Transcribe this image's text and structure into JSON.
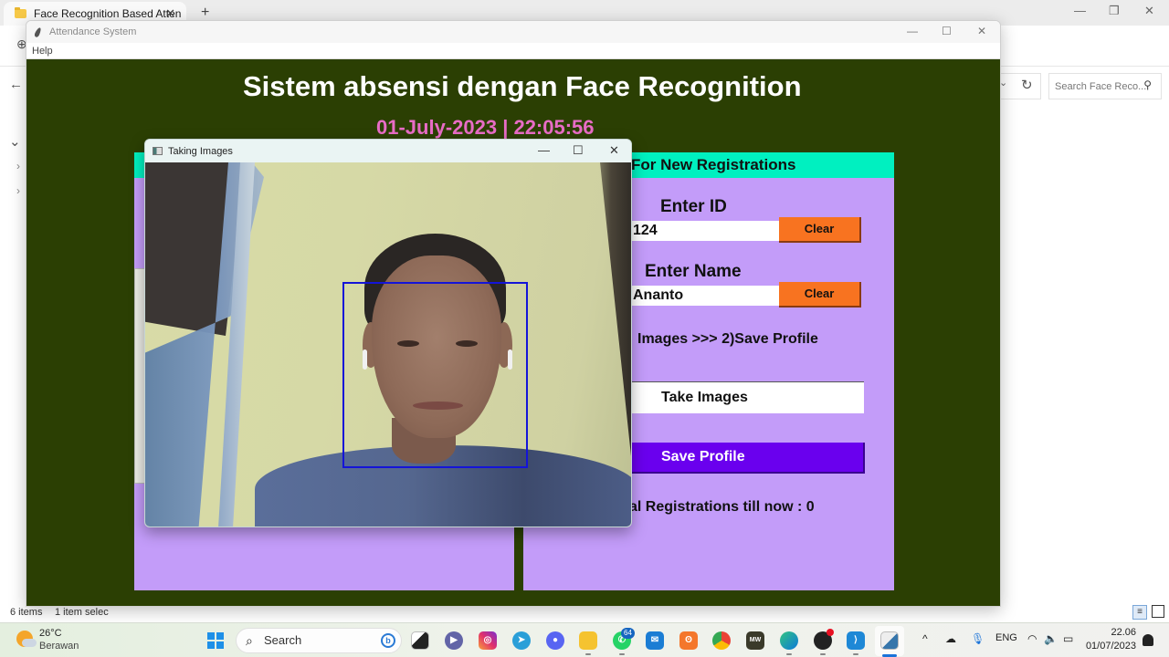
{
  "explorer": {
    "tab_title": "Face Recognition Based Atten",
    "tab_close": "✕",
    "new_tab": "+",
    "window_controls": {
      "minimize": "—",
      "maximize": "❐",
      "close": "✕"
    },
    "nav": {
      "back": "←",
      "expand": "⌄",
      "tree_arrow_1": "›",
      "tree_arrow_2": "›",
      "add": "⊕",
      "dropdown": "⌄"
    },
    "refresh": "↻",
    "search_placeholder": "Search Face Reco...",
    "search_icon": "⚲",
    "status": {
      "items": "6 items",
      "selected": "1 item selec"
    },
    "view_details": "≡"
  },
  "tk_app": {
    "window_title": "Attendance System",
    "window_controls": {
      "minimize": "—",
      "maximize": "☐",
      "close": "✕"
    },
    "menu": [
      "Help"
    ],
    "title": "Sistem absensi dengan Face Recognition",
    "datetime": "01-July-2023  |  22:05:56",
    "colors": {
      "background": "#2b3f03",
      "panel": "#c39cf9",
      "header": "#00f0c0",
      "clear_button": "#f87320",
      "save_button": "#6a00ee",
      "datetime": "#e86cc6"
    },
    "registration": {
      "header": "For New Registrations",
      "id_label": "Enter ID",
      "id_value": "124",
      "name_label": "Enter Name",
      "name_value": "Ananto",
      "clear_label": "Clear",
      "steps": "Images  >>>  2)Save Profile",
      "take_images": "Take Images",
      "save_profile": "Save Profile",
      "total": "al Registrations till now  : 0"
    }
  },
  "capture_window": {
    "title": "Taking Images",
    "window_controls": {
      "minimize": "—",
      "maximize": "☐",
      "close": "✕"
    },
    "face_detected": true
  },
  "taskbar": {
    "weather": {
      "temp": "26°C",
      "desc": "Berawan"
    },
    "search_label": "Search",
    "whatsapp_badge": "64",
    "apps": [
      "task-view",
      "teams",
      "instagram",
      "telegram",
      "discord",
      "file-explorer",
      "whatsapp",
      "mail",
      "xampp",
      "chrome",
      "mw",
      "edge",
      "obs",
      "vscode",
      "python"
    ],
    "tray": {
      "chevron": "^",
      "language": "ENG"
    },
    "clock": {
      "time": "22.06",
      "date": "01/07/2023"
    }
  }
}
